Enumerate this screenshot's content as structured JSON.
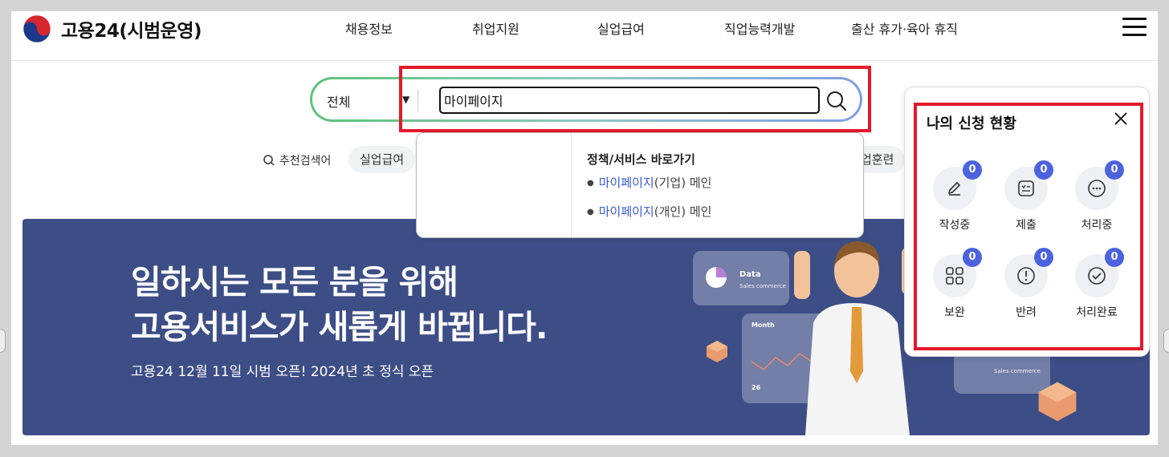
{
  "header": {
    "logo_text": "고용24(시범운영)",
    "nav": [
      "채용정보",
      "취업지원",
      "실업급여",
      "직업능력개발",
      "출산 휴가·육아 휴직"
    ]
  },
  "search": {
    "scope": "전체",
    "query": "마이페이지",
    "recommend_label": "추천검색어",
    "chips": [
      "실업급여",
      "업훈련"
    ]
  },
  "dropdown": {
    "title": "정책/서비스 바로가기",
    "links": [
      {
        "highlight": "마이페이지",
        "rest": "(기업) 메인"
      },
      {
        "highlight": "마이페이지",
        "rest": "(개인) 메인"
      }
    ]
  },
  "banner": {
    "line1": "일하시는 모든 분을 위해",
    "line2": "고용서비스가 새롭게 바뀝니다.",
    "subtitle": "고용24 12월 11일 시범 오픈! 2024년 초 정식 오픈",
    "card_data_title": "Data",
    "card_data_sub": "Sales commerce",
    "card_month_title": "Month",
    "card_month_value": "26",
    "card_small_sub": "Sales commerce"
  },
  "panel": {
    "title": "나의 신청 현황",
    "items": [
      {
        "label": "작성중",
        "count": "0",
        "icon": "pencil-icon"
      },
      {
        "label": "제출",
        "count": "0",
        "icon": "checklist-icon"
      },
      {
        "label": "처리중",
        "count": "0",
        "icon": "ellipsis-icon"
      },
      {
        "label": "보완",
        "count": "0",
        "icon": "grid-icon"
      },
      {
        "label": "반려",
        "count": "0",
        "icon": "exclamation-icon"
      },
      {
        "label": "처리완료",
        "count": "0",
        "icon": "check-circle-icon"
      }
    ]
  },
  "colors": {
    "accent_red": "#e3192a",
    "badge_blue": "#4b63de",
    "banner_bg": "#3d4e86",
    "link_blue": "#3c5bd6"
  }
}
